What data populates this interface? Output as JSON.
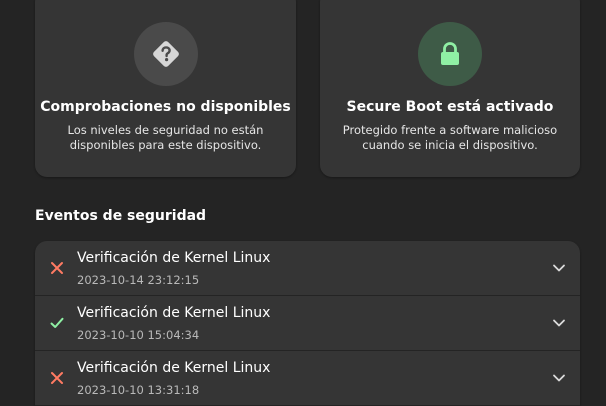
{
  "cards": [
    {
      "icon": "question-diamond-icon",
      "title": "Comprobaciones no disponibles",
      "description": "Los niveles de seguridad no están\ndisponibles para este dispositivo.",
      "icon_bg": "#4a4a4a"
    },
    {
      "icon": "lock-icon",
      "title": "Secure Boot está activado",
      "description": "Protegido frente a software malicioso\ncuando se inicia el dispositivo.",
      "icon_bg": "#3e5b47",
      "accent": "#8ff0a4"
    }
  ],
  "events": {
    "heading": "Eventos de seguridad",
    "items": [
      {
        "title": "Verificación de Kernel Linux",
        "timestamp": "2023-10-14 23:12:15",
        "status": "failed",
        "status_icon": "x-icon"
      },
      {
        "title": "Verificación de Kernel Linux",
        "timestamp": "2023-10-10 15:04:34",
        "status": "passed",
        "status_icon": "checkmark-icon"
      },
      {
        "title": "Verificación de Kernel Linux",
        "timestamp": "2023-10-10 13:31:18",
        "status": "failed",
        "status_icon": "x-icon"
      }
    ]
  },
  "colors": {
    "background": "#242424",
    "card": "#353535",
    "error": "#ff7b63",
    "success": "#8ff0a4"
  }
}
